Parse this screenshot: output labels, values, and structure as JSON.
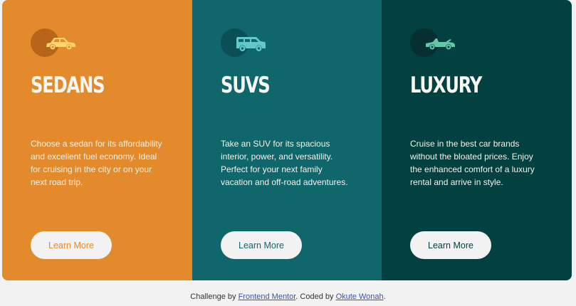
{
  "cards": [
    {
      "title": "SEDANS",
      "description": "Choose a sedan for its affordability and excellent fuel economy. Ideal for cruising in the city or on your next road trip.",
      "button_label": "Learn More",
      "icon": "sedan-car-icon",
      "color": "#e28a2c"
    },
    {
      "title": "SUVS",
      "description": "Take an SUV for its spacious interior, power, and versatility. Perfect for your next family vacation and off-road adventures.",
      "button_label": "Learn More",
      "icon": "suv-car-icon",
      "color": "#0f666b"
    },
    {
      "title": "LUXURY",
      "description": "Cruise in the best car brands without the bloated prices. Enjoy the enhanced comfort of a luxury rental and arrive in style.",
      "button_label": "Learn More",
      "icon": "luxury-car-icon",
      "color": "#034040"
    }
  ],
  "attribution": {
    "prefix": "Challenge by",
    "challenge_link": "Frontend Mentor",
    "middle": ". Coded by",
    "author_link": "Okute Wonah",
    "suffix": "."
  },
  "colors": {
    "background": "#f2f2f2",
    "button_bg": "#f2f2f2",
    "heading": "#f7f7f2"
  }
}
